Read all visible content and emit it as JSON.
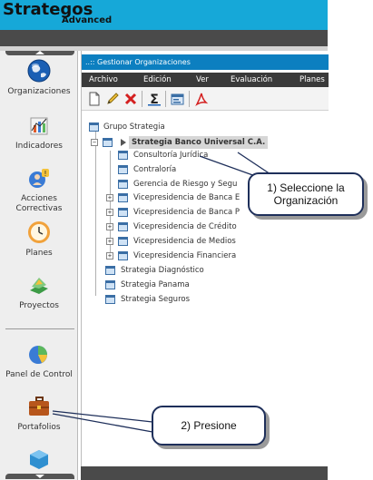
{
  "app": {
    "brand": "Strategos",
    "edition": "Advanced"
  },
  "sidebar": {
    "items": [
      {
        "label": "Organizaciones",
        "icon": "globe-icon"
      },
      {
        "label": "Indicadores",
        "icon": "indicators-chart-icon"
      },
      {
        "label": "Acciones Correctivas",
        "icon": "corrective-actions-icon"
      },
      {
        "label": "Planes",
        "icon": "clock-icon"
      },
      {
        "label": "Proyectos",
        "icon": "projects-icon"
      },
      {
        "label": "Panel de Control",
        "icon": "dashboard-icon"
      },
      {
        "label": "Portafolios",
        "icon": "briefcase-icon"
      }
    ]
  },
  "panel": {
    "title": "..:: Gestionar Organizaciones",
    "menu": [
      "Archivo",
      "Edición",
      "Ver",
      "Evaluación",
      "Planes"
    ],
    "toolbar": [
      "new-icon",
      "edit-icon",
      "delete-icon",
      "sum-icon",
      "properties-icon",
      "pdf-icon"
    ]
  },
  "tree": {
    "root": "Grupo Strategia",
    "selected": "Strategia Banco Universal C.A.",
    "children": [
      "Consultoría Jurídica",
      "Contraloría",
      "Gerencia de Riesgo y Segu",
      "Vicepresidencia de Banca E",
      "Vicepresidencia de Banca P",
      "Vicepresidencia de Crédito",
      "Vicepresidencia de Medios",
      "Vicepresidencia Financiera"
    ],
    "siblings": [
      "Strategia Diagnóstico",
      "Strategia Panama",
      "Strategia Seguros"
    ]
  },
  "callouts": {
    "first": "1) Seleccione la Organización",
    "second": "2) Presione"
  },
  "colors": {
    "header": "#16a8d8",
    "title_bar": "#0c7fc0",
    "menu_bar": "#3a3a3a",
    "callout_border": "#1e2f5a"
  }
}
